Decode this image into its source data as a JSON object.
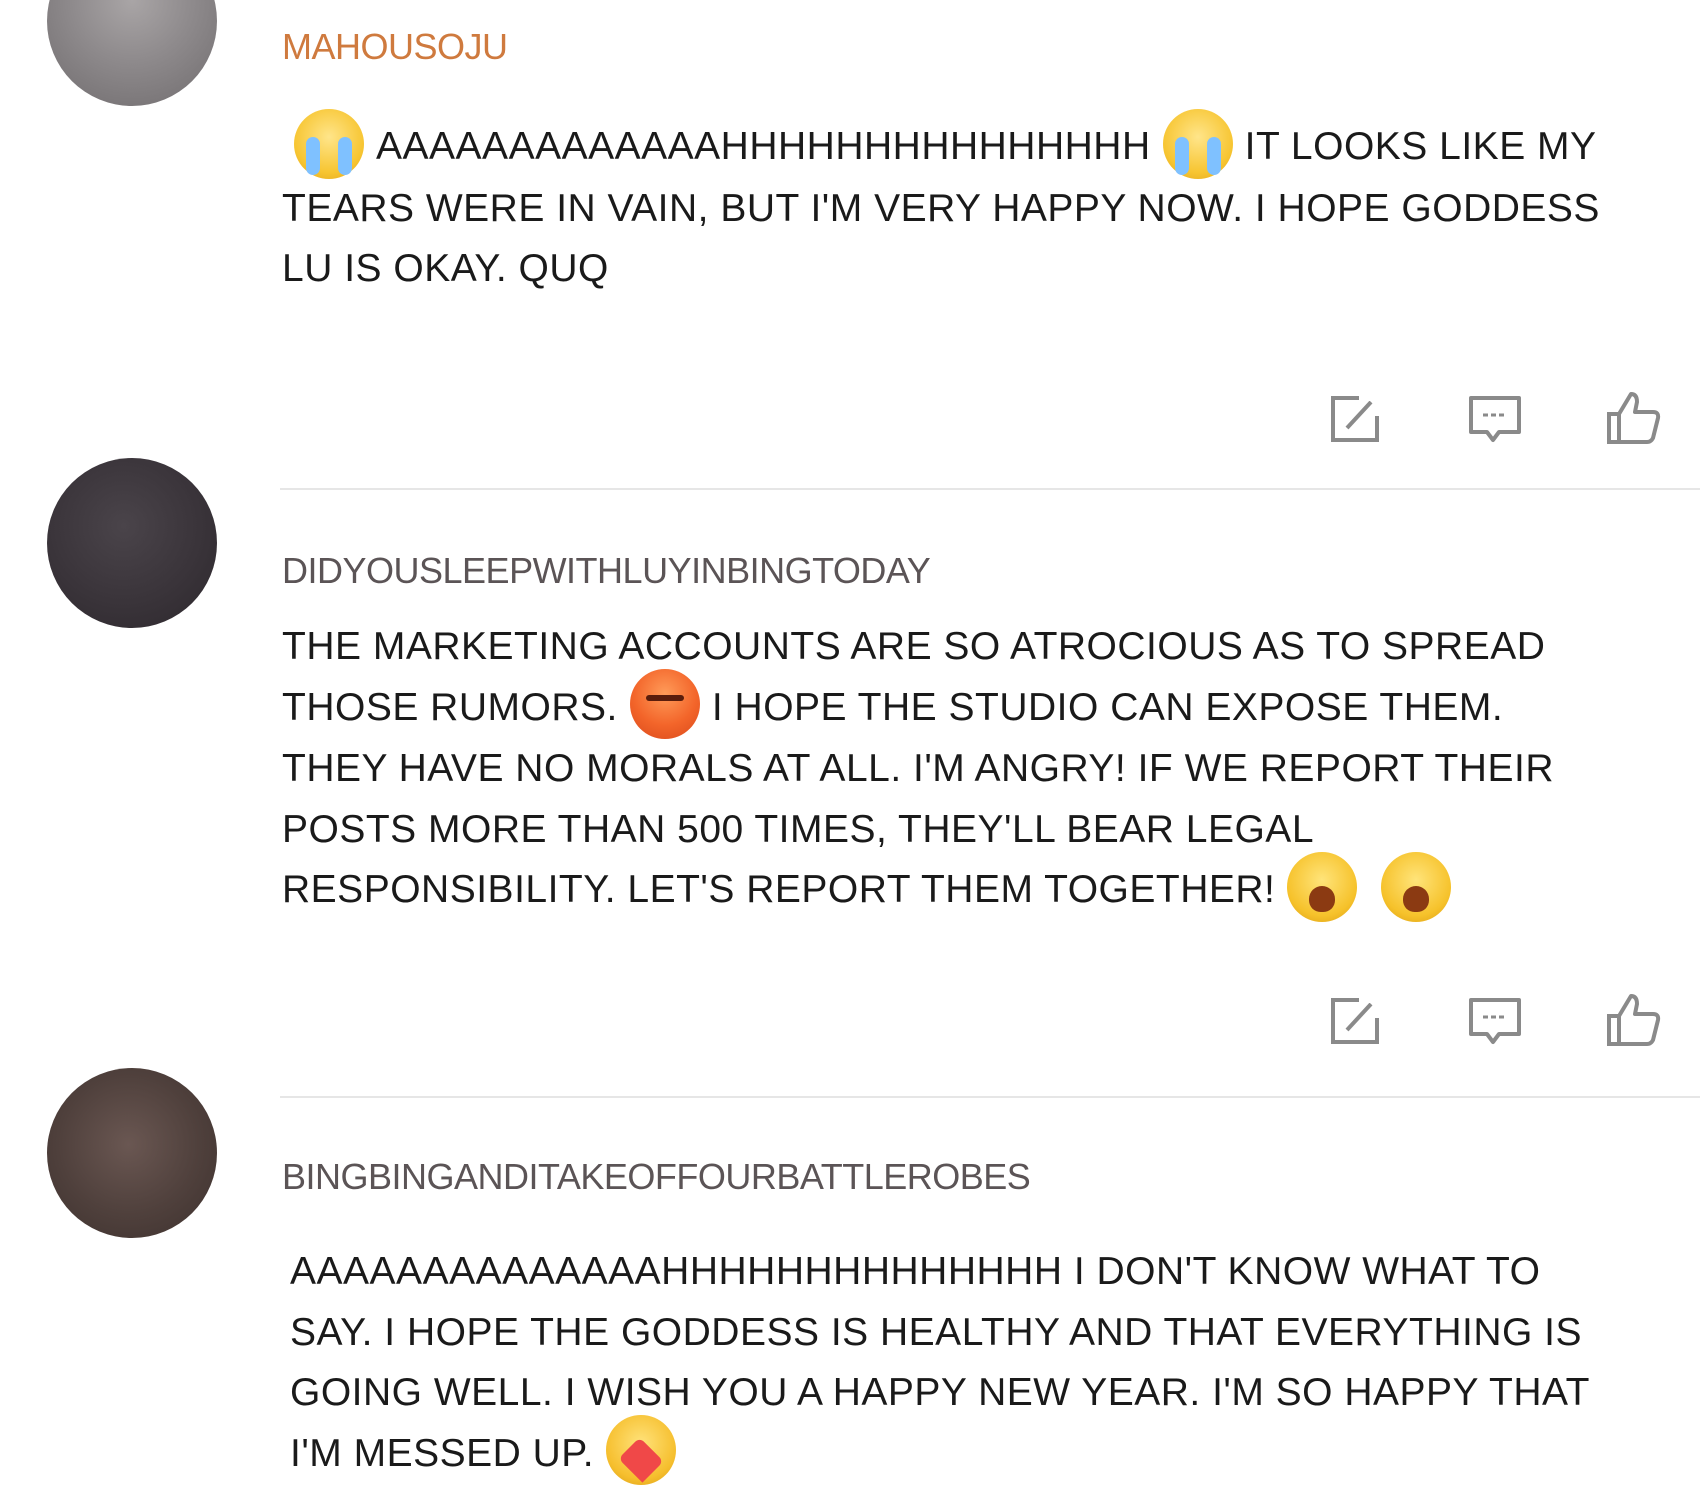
{
  "comments": [
    {
      "username": "Mahousoju",
      "username_color": "#cf7a3e",
      "avatar_icon": "avatar",
      "segments": [
        {
          "type": "emoji",
          "name": "crying-emoji"
        },
        {
          "type": "text",
          "text": "AAAAAAAAAAAAAHHHHHHHHHHHHHHH"
        },
        {
          "type": "emoji",
          "name": "crying-emoji"
        },
        {
          "type": "text",
          "text": "IT LOOKS LIKE MY TEARS WERE IN VAIN, BUT I'M VERY HAPPY NOW. I HOPE GODDESS LU IS OKAY. QUQ"
        }
      ]
    },
    {
      "username": "DidYouSleepWithLuYinbingToday",
      "username_color": "#5b5456",
      "avatar_icon": "avatar",
      "segments": [
        {
          "type": "text",
          "text": "THE MARKETING ACCOUNTS ARE SO ATROCIOUS AS TO SPREAD THOSE RUMORS."
        },
        {
          "type": "emoji",
          "name": "angry-emoji"
        },
        {
          "type": "text",
          "text": "I HOPE THE STUDIO CAN EXPOSE THEM. THEY HAVE NO MORALS AT ALL. I'M ANGRY! IF WE REPORT THEIR POSTS MORE THAN 500 TIMES, THEY'LL BEAR LEGAL RESPONSIBILITY. LET'S REPORT THEM TOGETHER!"
        },
        {
          "type": "emoji",
          "name": "yelling-emoji"
        },
        {
          "type": "emoji",
          "name": "yelling-emoji"
        }
      ]
    },
    {
      "username": "BingbingAndITakeOffOurBattleRobes",
      "username_color": "#5b5456",
      "avatar_icon": "avatar",
      "segments": [
        {
          "type": "text",
          "text": "AAAAAAAAAAAAAAHHHHHHHHHHHHHH I DON'T KNOW WHAT TO SAY. I HOPE THE GODDESS IS HEALTHY AND THAT EVERYTHING IS GOING WELL. I WISH YOU A HAPPY NEW YEAR. I'M SO HAPPY THAT I'M MESSED UP."
        },
        {
          "type": "emoji",
          "name": "hugging-emoji"
        }
      ]
    }
  ],
  "actions": {
    "share_icon": "share-icon",
    "reply_icon": "comment-icon",
    "like_icon": "thumbs-up-icon",
    "icon_color": "#8a8a8a"
  }
}
